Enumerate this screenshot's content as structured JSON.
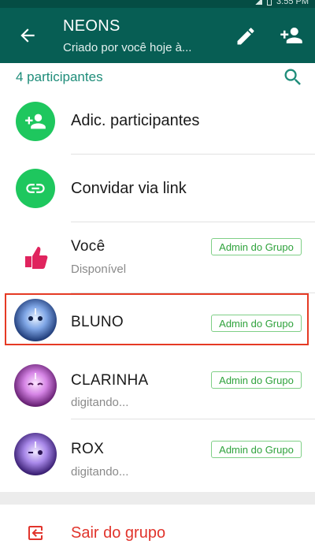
{
  "status_bar": {
    "time": "3:55 PM"
  },
  "header": {
    "title": "NEONS",
    "subtitle": "Criado por você hoje à...",
    "back_icon": "arrow-back-icon",
    "edit_icon": "pencil-icon",
    "add_participant_icon": "person-add-icon"
  },
  "participants_header": {
    "count_label": "4 participantes",
    "search_icon": "search-icon"
  },
  "actions": [
    {
      "label": "Adic. participantes",
      "icon": "person-add-icon"
    },
    {
      "label": "Convidar via link",
      "icon": "link-icon"
    }
  ],
  "participants": [
    {
      "name": "Você",
      "status": "Disponível",
      "badge": "Admin do Grupo"
    },
    {
      "name": "BLUNO",
      "status": "",
      "badge": "Admin do Grupo"
    },
    {
      "name": "CLARINHA",
      "status": "digitando...",
      "badge": "Admin do Grupo"
    },
    {
      "name": "ROX",
      "status": "digitando...",
      "badge": "Admin do Grupo"
    }
  ],
  "exit": {
    "label": "Sair do grupo",
    "icon": "exit-icon"
  },
  "colors": {
    "app_bar": "#075e54",
    "accent": "#1f8d7a",
    "green_avatar": "#1ec75e",
    "badge": "#2fa23c",
    "danger": "#e1342c",
    "highlight": "#e53a24"
  }
}
